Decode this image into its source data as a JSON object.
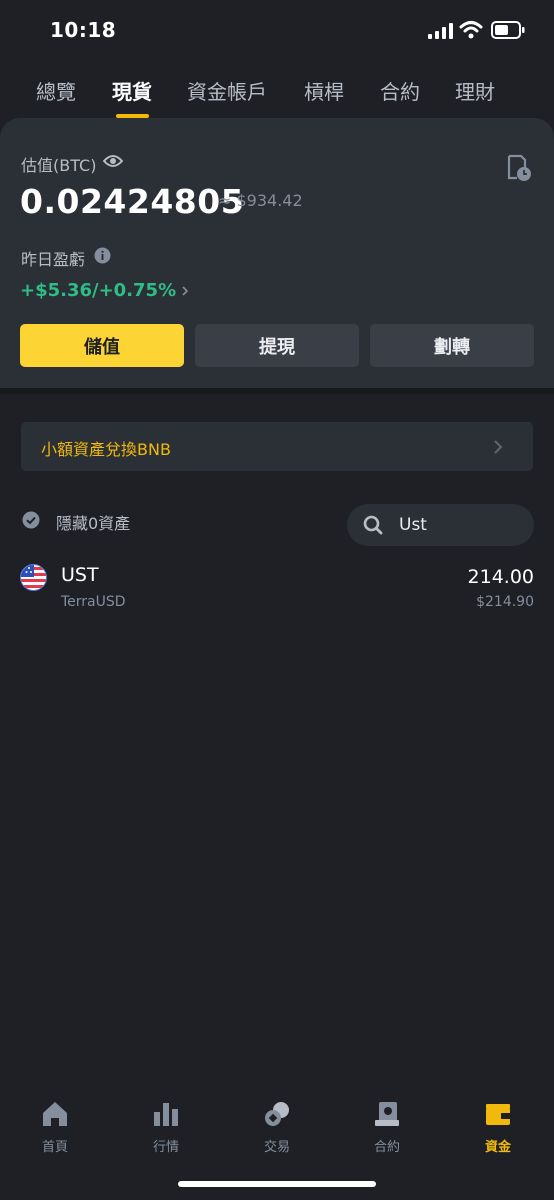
{
  "status_bar": {
    "time": "10:18"
  },
  "top_tabs": [
    {
      "label": "總覽",
      "active": false
    },
    {
      "label": "現貨",
      "active": true
    },
    {
      "label": "資金帳戶",
      "active": false
    },
    {
      "label": "槓桿",
      "active": false
    },
    {
      "label": "合約",
      "active": false
    },
    {
      "label": "理財",
      "active": false
    }
  ],
  "summary": {
    "estimate_label": "估值(BTC)",
    "btc_value": "0.02424805",
    "usd_approx": "≈ $934.42",
    "pnl_label": "昨日盈虧",
    "pnl_value": "+$5.36/+0.75%"
  },
  "actions": {
    "deposit": "儲值",
    "withdraw": "提現",
    "transfer": "劃轉"
  },
  "bnb_convert": {
    "label": "小額資產兌換BNB"
  },
  "filters": {
    "hide_zero_label": "隱藏0資產",
    "search_value": "Ust"
  },
  "assets": [
    {
      "symbol": "UST",
      "name": "TerraUSD",
      "amount": "214.00",
      "usd_value": "$214.90"
    }
  ],
  "bottom_nav": [
    {
      "label": "首頁",
      "icon": "home-icon",
      "active": false
    },
    {
      "label": "行情",
      "icon": "markets-icon",
      "active": false
    },
    {
      "label": "交易",
      "icon": "trade-icon",
      "active": false
    },
    {
      "label": "合約",
      "icon": "futures-icon",
      "active": false
    },
    {
      "label": "資金",
      "icon": "wallet-icon",
      "active": true
    }
  ],
  "colors": {
    "accent": "#f0b90b",
    "button_primary": "#fcd535",
    "positive": "#2ebd85",
    "background": "#1e2026",
    "card": "#2b2f36"
  }
}
